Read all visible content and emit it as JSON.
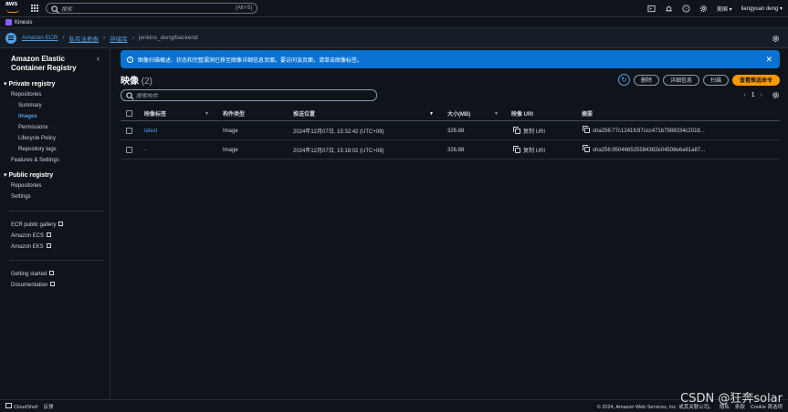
{
  "topbar": {
    "logo": "aws",
    "search_placeholder": "搜索",
    "search_shortcut": "[Alt+S]",
    "region": "美国",
    "user": "liangyuan deng"
  },
  "service_bar": {
    "label": "Kinesis"
  },
  "breadcrumb": {
    "items": [
      "Amazon ECR",
      "私有注册表",
      "存储库"
    ],
    "current": "jenkins_deng/backend"
  },
  "sidenav": {
    "title": "Amazon Elastic Container Registry",
    "private_registry": "Private registry",
    "private_items": [
      "Repositories",
      "Summary",
      "Images",
      "Permissions",
      "Lifecycle Policy",
      "Repository tags",
      "Features & Settings"
    ],
    "public_registry": "Public registry",
    "public_items": [
      "Repositories",
      "Settings"
    ],
    "external_links": [
      "ECR public gallery",
      "Amazon ECS",
      "Amazon EKS"
    ],
    "help_links": [
      "Getting started",
      "Documentation"
    ]
  },
  "flash": {
    "message": "图像扫描概述、状态和完整漏洞已移至图像详细信息页面。要访问该页面，请单击图像标签。"
  },
  "header": {
    "title": "映像",
    "count": "(2)"
  },
  "buttons": {
    "delete": "删除",
    "details": "详细信息",
    "scan": "扫描",
    "push_commands": "查看推送命令"
  },
  "search": {
    "placeholder": "搜索构件"
  },
  "pager": {
    "page": "1"
  },
  "table": {
    "columns": [
      "映像标签",
      "构件类型",
      "推送位置",
      "大小(MB)",
      "映像 URI",
      "摘要"
    ],
    "rows": [
      {
        "tag": "latest",
        "type": "Image",
        "pushed": "2024年12月07日, 15:32:42 (UTC+08)",
        "size": "326.88",
        "uri": "复制 URI",
        "digest": "sha256:77c1241fc97ccc471b7988334c2018..."
      },
      {
        "tag": "-",
        "type": "Image",
        "pushed": "2024年12月07日, 15:18:02 (UTC+08)",
        "size": "326.88",
        "uri": "复制 URI",
        "digest": "sha256:950466525584382e04508e6a61a87..."
      }
    ]
  },
  "footer": {
    "cloudshell": "CloudShell",
    "feedback": "反馈",
    "copyright": "© 2024, Amazon Web Services, Inc. 或其关联公司。",
    "privacy": "隐私",
    "terms": "条款",
    "cookie": "Cookie 首选项"
  },
  "watermark": "CSDN @狂奔solar",
  "colors": {
    "accent": "#539fe5",
    "primary_button": "#ff9900",
    "flash": "#0972d3",
    "background": "#0f141a"
  }
}
